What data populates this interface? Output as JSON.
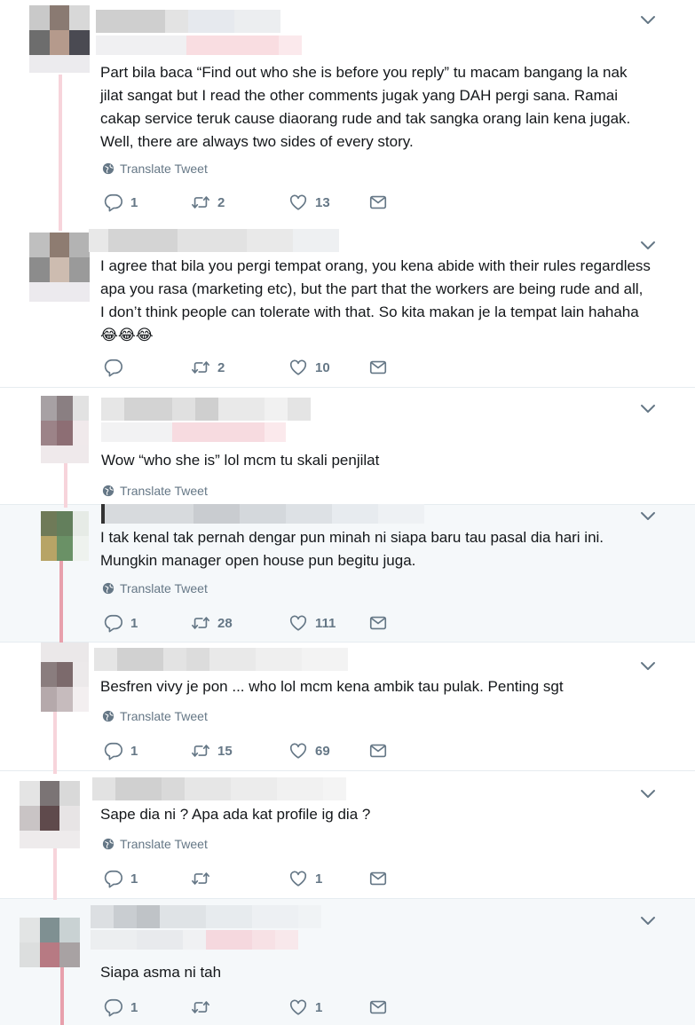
{
  "ui": {
    "translate_label": "Translate Tweet"
  },
  "tweets": [
    {
      "text": "Part bila baca “Find out who she is before you reply” tu macam bangang la nak jilat sangat but I read the other comments jugak yang DAH pergi sana. Ramai cakap service teruk cause diaorang rude and tak sangka orang lain kena jugak. Well, there are always two sides of every story.",
      "replies": "1",
      "retweets": "2",
      "likes": "13"
    },
    {
      "text": "I agree that bila you pergi tempat orang, you kena abide with their rules regardless apa you rasa (marketing etc), but the part that the workers are being rude and all, I don’t think people can tolerate with that. So kita makan je la tempat lain hahaha 😂😂😂",
      "replies": "",
      "retweets": "2",
      "likes": "10"
    },
    {
      "text": "Wow “who she is” lol mcm tu skali penjilat"
    },
    {
      "text": "I tak kenal tak pernah dengar pun minah ni siapa baru tau pasal dia hari ini. Mungkin manager open house pun begitu juga.",
      "replies": "1",
      "retweets": "28",
      "likes": "111"
    },
    {
      "text": "Besfren vivy je pon ... who lol mcm kena ambik tau pulak. Penting sgt",
      "replies": "1",
      "retweets": "15",
      "likes": "69"
    },
    {
      "text": "Sape dia ni ? Apa ada kat profile ig dia ?",
      "replies": "1",
      "retweets": "",
      "likes": "1"
    },
    {
      "text": "Siapa asma ni tah",
      "replies": "1",
      "retweets": "",
      "likes": "1"
    }
  ]
}
